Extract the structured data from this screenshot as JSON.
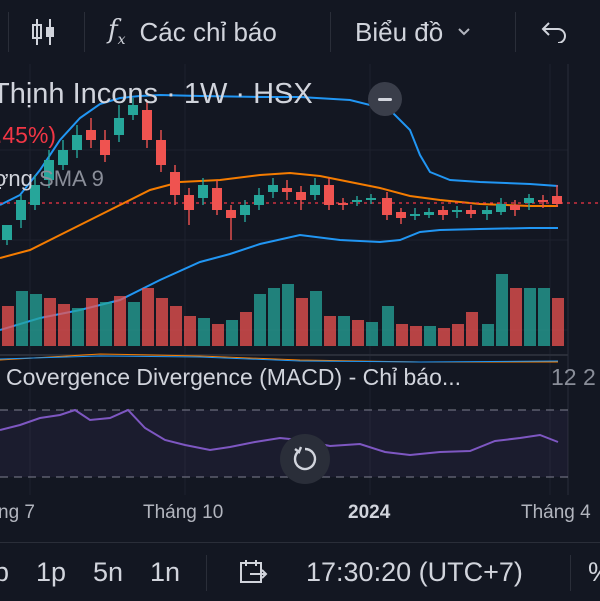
{
  "toolbar": {
    "indicators_label": "Các chỉ báo",
    "chart_type_label": "Biểu đồ",
    "colors": {
      "background": "#131722",
      "text": "#d1d4dc"
    }
  },
  "header": {
    "symbol_title": "Thịnh Incons · 1W · HSX",
    "change_pct": ".45%)",
    "ma_label": "ợng",
    "sma_label": "SMA 9"
  },
  "macd": {
    "title": "Covergence Divergence (MACD) - Chỉ báo...",
    "params": "12 2"
  },
  "time_axis": [
    "ng 7",
    "Tháng 10",
    "2024",
    "Tháng 4"
  ],
  "bottom_bar": {
    "intervals": [
      "p",
      "1p",
      "5n",
      "1n"
    ],
    "clock": "17:30:20 (UTC+7)",
    "extra": "%"
  },
  "colors": {
    "up": "#26a69a",
    "down": "#ef5350",
    "bollinger": "#2196f3",
    "ma_orange": "#f57c00",
    "macd_line": "#7e57c2",
    "last_price_line": "#f23645"
  },
  "chart_data": {
    "type": "candlestick",
    "price_line": "dashed red at last close",
    "candles_approx": "weekly candles: strong rally to peak, drop, then sideways consolidation into 2024",
    "volume": "bars colored by candle direction",
    "macd_histogram": "purple line oscillator with dashed levels"
  }
}
